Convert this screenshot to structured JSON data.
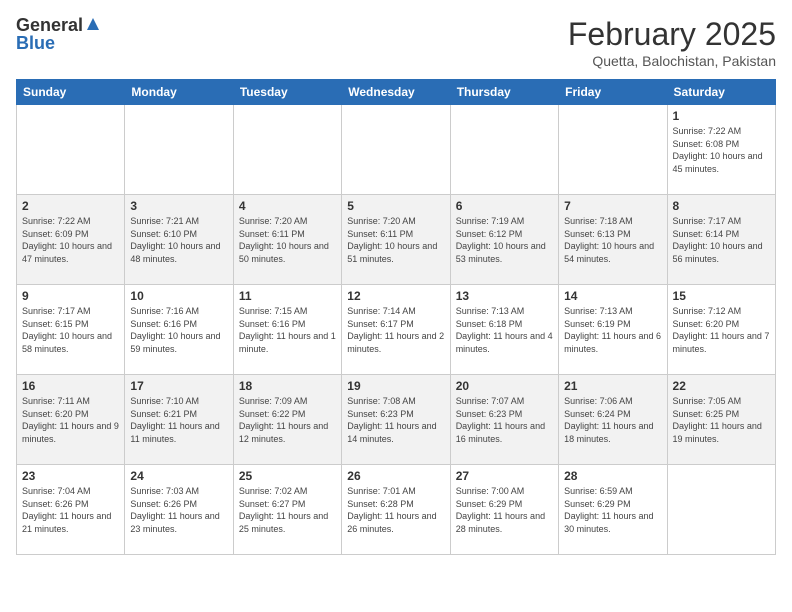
{
  "header": {
    "logo_general": "General",
    "logo_blue": "Blue",
    "month_year": "February 2025",
    "location": "Quetta, Balochistan, Pakistan"
  },
  "weekdays": [
    "Sunday",
    "Monday",
    "Tuesday",
    "Wednesday",
    "Thursday",
    "Friday",
    "Saturday"
  ],
  "weeks": [
    [
      {
        "day": "",
        "info": ""
      },
      {
        "day": "",
        "info": ""
      },
      {
        "day": "",
        "info": ""
      },
      {
        "day": "",
        "info": ""
      },
      {
        "day": "",
        "info": ""
      },
      {
        "day": "",
        "info": ""
      },
      {
        "day": "1",
        "info": "Sunrise: 7:22 AM\nSunset: 6:08 PM\nDaylight: 10 hours and 45 minutes."
      }
    ],
    [
      {
        "day": "2",
        "info": "Sunrise: 7:22 AM\nSunset: 6:09 PM\nDaylight: 10 hours and 47 minutes."
      },
      {
        "day": "3",
        "info": "Sunrise: 7:21 AM\nSunset: 6:10 PM\nDaylight: 10 hours and 48 minutes."
      },
      {
        "day": "4",
        "info": "Sunrise: 7:20 AM\nSunset: 6:11 PM\nDaylight: 10 hours and 50 minutes."
      },
      {
        "day": "5",
        "info": "Sunrise: 7:20 AM\nSunset: 6:11 PM\nDaylight: 10 hours and 51 minutes."
      },
      {
        "day": "6",
        "info": "Sunrise: 7:19 AM\nSunset: 6:12 PM\nDaylight: 10 hours and 53 minutes."
      },
      {
        "day": "7",
        "info": "Sunrise: 7:18 AM\nSunset: 6:13 PM\nDaylight: 10 hours and 54 minutes."
      },
      {
        "day": "8",
        "info": "Sunrise: 7:17 AM\nSunset: 6:14 PM\nDaylight: 10 hours and 56 minutes."
      }
    ],
    [
      {
        "day": "9",
        "info": "Sunrise: 7:17 AM\nSunset: 6:15 PM\nDaylight: 10 hours and 58 minutes."
      },
      {
        "day": "10",
        "info": "Sunrise: 7:16 AM\nSunset: 6:16 PM\nDaylight: 10 hours and 59 minutes."
      },
      {
        "day": "11",
        "info": "Sunrise: 7:15 AM\nSunset: 6:16 PM\nDaylight: 11 hours and 1 minute."
      },
      {
        "day": "12",
        "info": "Sunrise: 7:14 AM\nSunset: 6:17 PM\nDaylight: 11 hours and 2 minutes."
      },
      {
        "day": "13",
        "info": "Sunrise: 7:13 AM\nSunset: 6:18 PM\nDaylight: 11 hours and 4 minutes."
      },
      {
        "day": "14",
        "info": "Sunrise: 7:13 AM\nSunset: 6:19 PM\nDaylight: 11 hours and 6 minutes."
      },
      {
        "day": "15",
        "info": "Sunrise: 7:12 AM\nSunset: 6:20 PM\nDaylight: 11 hours and 7 minutes."
      }
    ],
    [
      {
        "day": "16",
        "info": "Sunrise: 7:11 AM\nSunset: 6:20 PM\nDaylight: 11 hours and 9 minutes."
      },
      {
        "day": "17",
        "info": "Sunrise: 7:10 AM\nSunset: 6:21 PM\nDaylight: 11 hours and 11 minutes."
      },
      {
        "day": "18",
        "info": "Sunrise: 7:09 AM\nSunset: 6:22 PM\nDaylight: 11 hours and 12 minutes."
      },
      {
        "day": "19",
        "info": "Sunrise: 7:08 AM\nSunset: 6:23 PM\nDaylight: 11 hours and 14 minutes."
      },
      {
        "day": "20",
        "info": "Sunrise: 7:07 AM\nSunset: 6:23 PM\nDaylight: 11 hours and 16 minutes."
      },
      {
        "day": "21",
        "info": "Sunrise: 7:06 AM\nSunset: 6:24 PM\nDaylight: 11 hours and 18 minutes."
      },
      {
        "day": "22",
        "info": "Sunrise: 7:05 AM\nSunset: 6:25 PM\nDaylight: 11 hours and 19 minutes."
      }
    ],
    [
      {
        "day": "23",
        "info": "Sunrise: 7:04 AM\nSunset: 6:26 PM\nDaylight: 11 hours and 21 minutes."
      },
      {
        "day": "24",
        "info": "Sunrise: 7:03 AM\nSunset: 6:26 PM\nDaylight: 11 hours and 23 minutes."
      },
      {
        "day": "25",
        "info": "Sunrise: 7:02 AM\nSunset: 6:27 PM\nDaylight: 11 hours and 25 minutes."
      },
      {
        "day": "26",
        "info": "Sunrise: 7:01 AM\nSunset: 6:28 PM\nDaylight: 11 hours and 26 minutes."
      },
      {
        "day": "27",
        "info": "Sunrise: 7:00 AM\nSunset: 6:29 PM\nDaylight: 11 hours and 28 minutes."
      },
      {
        "day": "28",
        "info": "Sunrise: 6:59 AM\nSunset: 6:29 PM\nDaylight: 11 hours and 30 minutes."
      },
      {
        "day": "",
        "info": ""
      }
    ]
  ]
}
